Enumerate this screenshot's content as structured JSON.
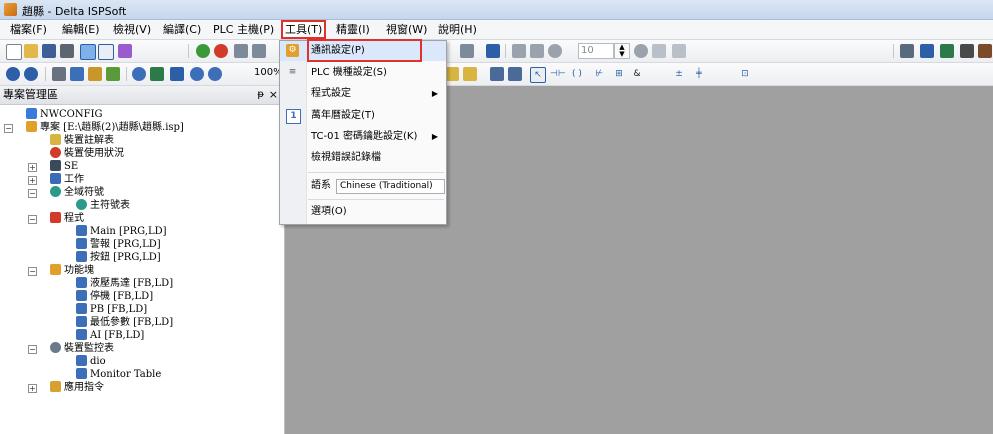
{
  "window": {
    "title": "趙縣 - Delta ISPSoft"
  },
  "menubar": {
    "items": [
      "檔案(F)",
      "編輯(E)",
      "檢視(V)",
      "編譯(C)",
      "PLC 主機(P)",
      "工具(T)",
      "精靈(I)",
      "視窗(W)",
      "說明(H)"
    ]
  },
  "toolbar": {
    "counter_value": "10",
    "zoom_label": "100%"
  },
  "panel": {
    "title": "專案管理區",
    "pin": "ᵽ",
    "close": "×",
    "tree": [
      "NWCONFIG",
      "專案 [E:\\趙縣(2)\\趙縣\\趙縣.isp]",
      "裝置註解表",
      "裝置使用狀況",
      "SE",
      "工作",
      "全域符號",
      "主符號表",
      "程式",
      "Main [PRG,LD]",
      "警報 [PRG,LD]",
      "按鈕 [PRG,LD]",
      "功能塊",
      "液壓馬達 [FB,LD]",
      "停機 [FB,LD]",
      "PB [FB,LD]",
      "最低參數 [FB,LD]",
      "AI [FB,LD]",
      "裝置監控表",
      "dio",
      "Monitor Table",
      "應用指令"
    ]
  },
  "dropdown": {
    "items": {
      "comm": "通訊設定(P)",
      "plc_model": "PLC 機種設定(S)",
      "program": "程式設定",
      "calendar": "萬年曆設定(T)",
      "tc01": "TC-01 密碼鑰匙設定(K)",
      "error_log": "檢視錯誤記錄檔",
      "language": "語系",
      "language_value": "Chinese (Traditional)",
      "options": "選項(O)"
    }
  },
  "colors": {
    "highlight": "#e0322a",
    "workspace": "#a0a0a0"
  }
}
